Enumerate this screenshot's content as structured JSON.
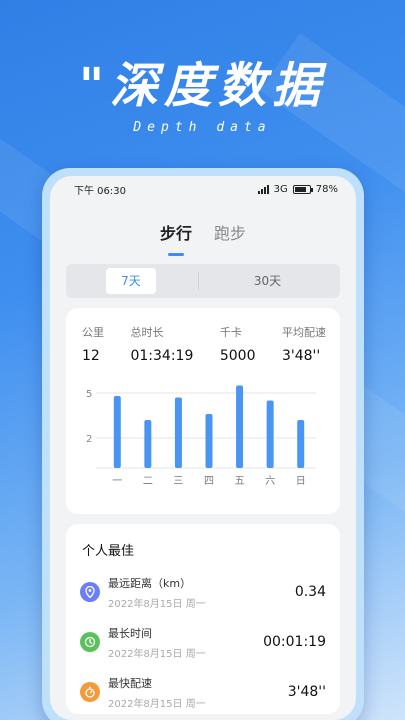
{
  "promo": {
    "title": "\"深度数据",
    "subtitle": "Depth data"
  },
  "status": {
    "time": "下午 06:30",
    "network": "3G",
    "battery": "78%"
  },
  "tabs": [
    {
      "label": "步行",
      "active": true
    },
    {
      "label": "跑步",
      "active": false
    }
  ],
  "segments": [
    {
      "label": "7天",
      "active": true
    },
    {
      "label": "30天",
      "active": false
    }
  ],
  "stats": [
    {
      "label": "公里",
      "value": "12"
    },
    {
      "label": "总时长",
      "value": "01:34:19"
    },
    {
      "label": "千卡",
      "value": "5000"
    },
    {
      "label": "平均配速",
      "value": "3'48''"
    }
  ],
  "chart_data": {
    "type": "bar",
    "categories": [
      "一",
      "二",
      "三",
      "四",
      "五",
      "六",
      "日"
    ],
    "values": [
      4.8,
      3.2,
      4.7,
      3.6,
      5.5,
      4.5,
      3.2
    ],
    "y_ticks": [
      "5",
      "2"
    ],
    "ylim": [
      0,
      6
    ],
    "color": "#4a94f2"
  },
  "best": {
    "title": "个人最佳",
    "items": [
      {
        "name": "最远距离（km）",
        "date": "2022年8月15日 周一",
        "value": "0.34",
        "icon": "location-pin-icon",
        "color": "#6a7ef5"
      },
      {
        "name": "最长时间",
        "date": "2022年8月15日 周一",
        "value": "00:01:19",
        "icon": "clock-icon",
        "color": "#5cc05c"
      },
      {
        "name": "最快配速",
        "date": "2022年8月15日 周一",
        "value": "3'48''",
        "icon": "speed-icon",
        "color": "#f39a3b"
      }
    ]
  }
}
